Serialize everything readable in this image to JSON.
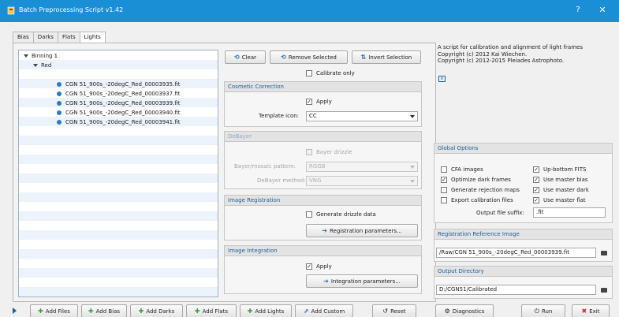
{
  "window": {
    "title": "Batch Preprocessing Script v1.42",
    "help_glyph": "?",
    "close_glyph": "✕"
  },
  "tabs": [
    "Bias",
    "Darks",
    "Flats",
    "Lights"
  ],
  "tree": {
    "root": "Binning 1",
    "group": "Red",
    "files": [
      "CGN 51_900s_-20degC_Red_00003935.fit",
      "CGN 51_900s_-20degC_Red_00003937.fit",
      "CGN 51_900s_-20degC_Red_00003939.fit",
      "CGN 51_900s_-20degC_Red_00003940.fit",
      "CGN 51_900s_-20degC_Red_00003941.fit"
    ]
  },
  "toolbar": {
    "clear": "Clear",
    "remove_selected": "Remove Selected",
    "invert_selection": "Invert Selection"
  },
  "calibrate_only": "Calibrate only",
  "cosmetic": {
    "title": "Cosmetic Correction",
    "apply": "Apply",
    "template_label": "Template icon:",
    "template_value": "CC"
  },
  "debayer": {
    "title": "DeBayer",
    "bayer_drizzle": "Bayer drizzle",
    "pattern_label": "Bayer/mosaic pattern:",
    "pattern_value": "RGGB",
    "method_label": "DeBayer method:",
    "method_value": "VNG"
  },
  "registration": {
    "title": "Image Registration",
    "drizzle": "Generate drizzle data",
    "params": "Registration parameters..."
  },
  "integration": {
    "title": "Image Integration",
    "apply": "Apply",
    "params": "Integration parameters..."
  },
  "info": {
    "line1": "A script for calibration and alignment of light frames",
    "line2": "Copyright (c) 2012 Kai Wiechen.",
    "line3": "Copyright (c) 2012-2015 Pleiades Astrophoto."
  },
  "global_options": {
    "title": "Global Options",
    "cfa": "CFA images",
    "optimize": "Optimize dark frames",
    "rejection": "Generate rejection maps",
    "export": "Export calibration files",
    "up_bottom": "Up-bottom FITS",
    "master_bias": "Use master bias",
    "master_dark": "Use master dark",
    "master_flat": "Use master flat",
    "suffix_label": "Output file suffix:",
    "suffix_value": ".fit"
  },
  "reference": {
    "title": "Registration Reference Image",
    "value": "/Raw/CGN 51_900s_-20degC_Red_00003939.fit"
  },
  "output": {
    "title": "Output Directory",
    "value": "D:/CGN51/Calibrated"
  },
  "bottom": {
    "add_files": "Add Files",
    "add_bias": "Add Bias",
    "add_darks": "Add Darks",
    "add_flats": "Add Flats",
    "add_lights": "Add Lights",
    "add_custom": "Add Custom",
    "reset": "Reset",
    "diagnostics": "Diagnostics",
    "run": "Run",
    "exit": "Exit"
  },
  "colors": {
    "titlebar": "#1b8fd6",
    "accent": "#1a5f9c",
    "add_green": "#2ea043"
  }
}
